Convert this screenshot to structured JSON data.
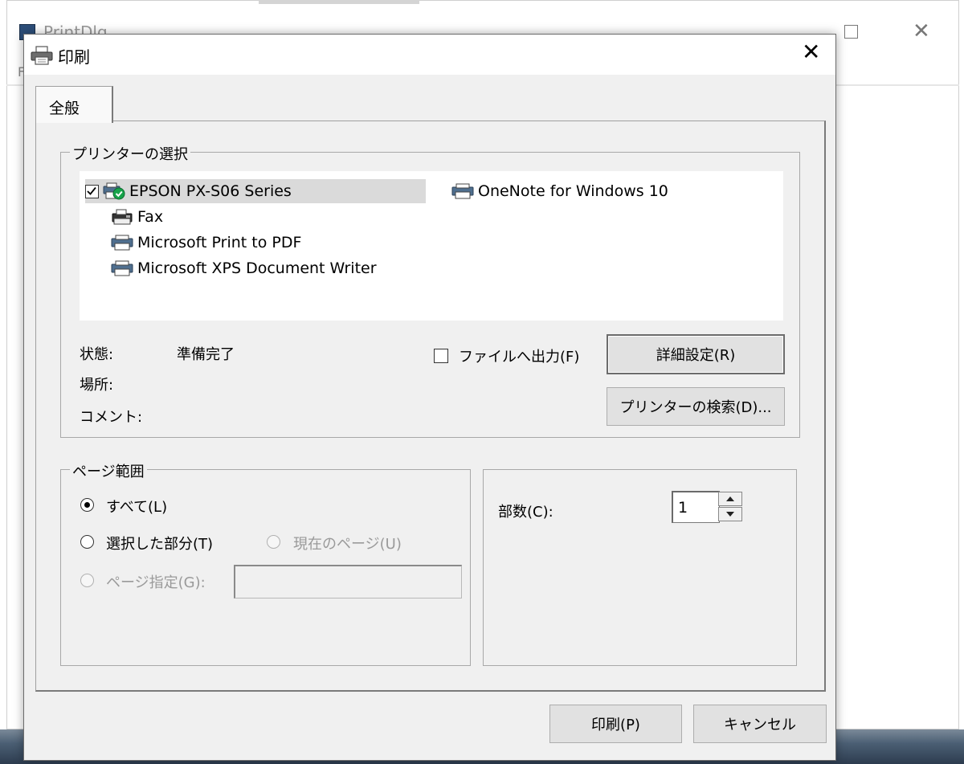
{
  "background_window": {
    "title": "PrintDlg",
    "menu_letter": "F"
  },
  "dialog": {
    "title": "印刷",
    "tab_label": "全般",
    "printer_group": {
      "legend": "プリンターの選択",
      "printers": [
        {
          "name": "EPSON PX-S06 Series",
          "selected": true,
          "default": true
        },
        {
          "name": "Fax"
        },
        {
          "name": "Microsoft Print to PDF"
        },
        {
          "name": "Microsoft XPS Document Writer"
        },
        {
          "name": "OneNote for Windows 10"
        }
      ],
      "status_label": "状態:",
      "status_value": "準備完了",
      "location_label": "場所:",
      "comment_label": "コメント:",
      "print_to_file_label": "ファイルへ出力(F)",
      "preferences_button": "詳細設定(R)",
      "find_printer_button": "プリンターの検索(D)..."
    },
    "page_range": {
      "legend": "ページ範囲",
      "all_label": "すべて(L)",
      "selection_label": "選択した部分(T)",
      "current_page_label": "現在のページ(U)",
      "pages_label": "ページ指定(G):",
      "selected_option": "all"
    },
    "copies": {
      "label": "部数(C):",
      "value": "1"
    },
    "print_button": "印刷(P)",
    "cancel_button": "キャンセル"
  }
}
